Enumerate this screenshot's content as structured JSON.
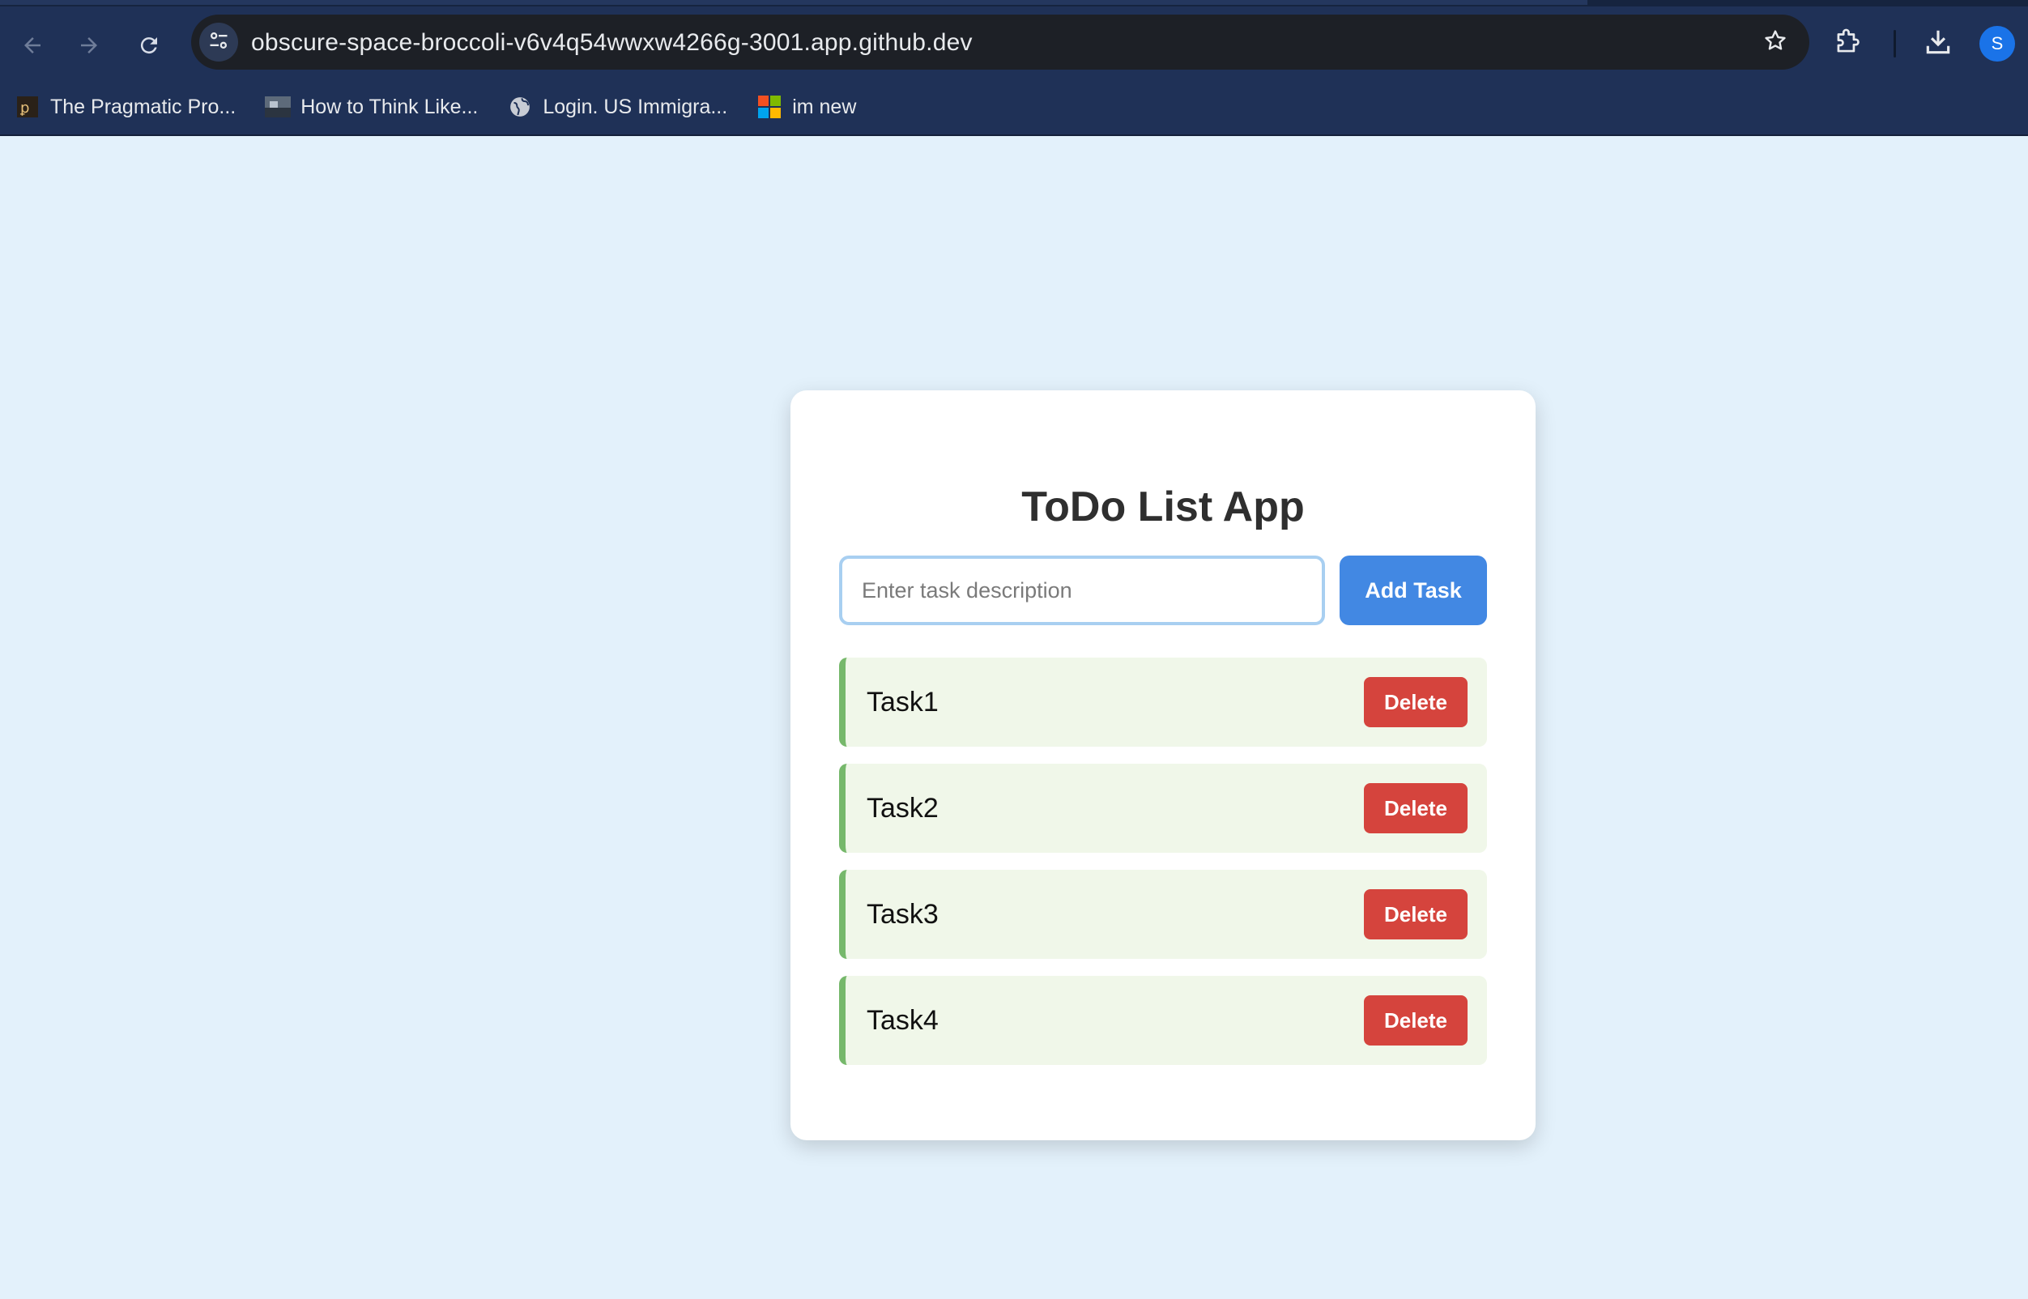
{
  "browser": {
    "url": "obscure-space-broccoli-v6v4q54wwxw4266g-3001.app.github.dev",
    "profile_initial": "S",
    "nav_icons": [
      "back-arrow-icon",
      "forward-arrow-icon",
      "reload-icon"
    ],
    "bookmarks": [
      {
        "label": "The Pragmatic Pro...",
        "icon": "pragmatic-programmer-icon"
      },
      {
        "label": "How to Think Like...",
        "icon": "book-thumbnail-icon"
      },
      {
        "label": "Login. US Immigra...",
        "icon": "globe-icon"
      },
      {
        "label": "im new",
        "icon": "microsoft-icon"
      }
    ],
    "colors": {
      "frame": "#1f3157",
      "omnibox": "#1d2026"
    }
  },
  "app": {
    "title": "ToDo List App",
    "input": {
      "placeholder": "Enter task description",
      "value": ""
    },
    "add_button_label": "Add Task",
    "tasks": [
      {
        "label": "Task1",
        "delete_label": "Delete"
      },
      {
        "label": "Task2",
        "delete_label": "Delete"
      },
      {
        "label": "Task3",
        "delete_label": "Delete"
      },
      {
        "label": "Task4",
        "delete_label": "Delete"
      }
    ],
    "colors": {
      "page_bg": "#e3f1fb",
      "primary": "#4288e3",
      "danger": "#d5443d",
      "task_bg": "#f0f7e9",
      "task_accent": "#76b86b"
    }
  }
}
